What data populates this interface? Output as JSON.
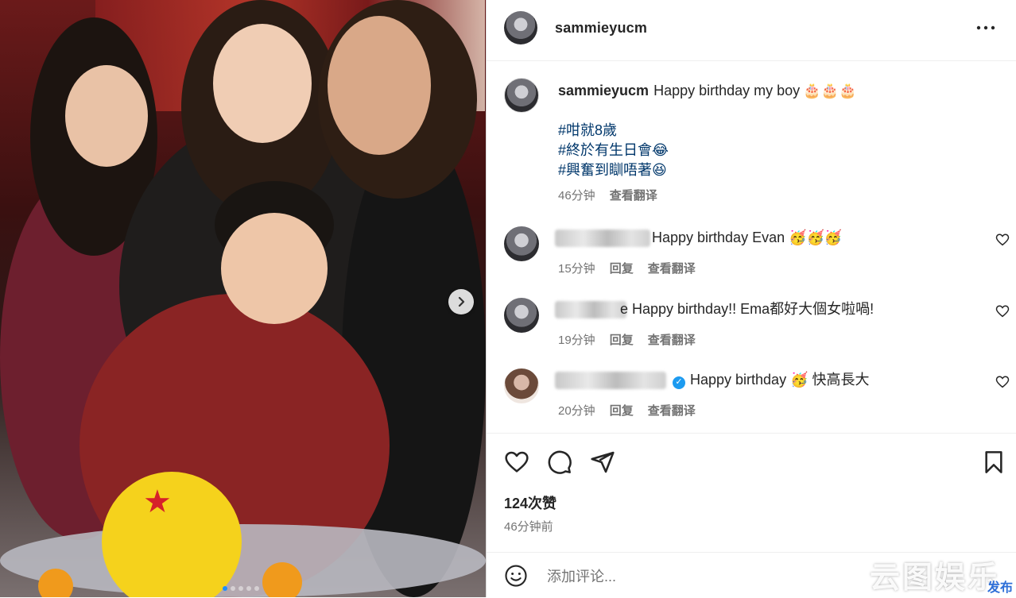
{
  "post": {
    "username": "sammieyucm",
    "caption": {
      "username": "sammieyucm",
      "text": "Happy birthday my boy",
      "emoji": "🎂🎂🎂",
      "hashtags": [
        "#咁就8歲",
        "#終於有生日會😂",
        "#興奮到瞓唔著😆"
      ],
      "time": "46分钟",
      "translate": "查看翻译"
    },
    "comments": [
      {
        "name_hidden": "",
        "text": "Happy birthday Evan 🥳🥳🥳",
        "time": "15分钟",
        "reply": "回复",
        "translate": "查看翻译",
        "like_icon": "heart-outline-icon"
      },
      {
        "name_hidden": "",
        "text": "e Happy birthday!! Ema都好大個女啦喎!",
        "time": "19分钟",
        "reply": "回复",
        "translate": "查看翻译",
        "like_icon": "heart-outline-icon"
      },
      {
        "name_hidden": "",
        "verified": true,
        "text": "Happy birthday 🥳 快高長大",
        "time": "20分钟",
        "reply": "回复",
        "translate": "查看翻译",
        "like_icon": "heart-outline-icon"
      }
    ],
    "likes": "124次赞",
    "posted_ago": "46分钟前",
    "add_comment_placeholder": "添加评论...",
    "carousel": {
      "slides": 5,
      "active_index": 0
    }
  },
  "watermark": {
    "text": "云图娱乐",
    "sub": "发布"
  },
  "colors": {
    "link": "#00376b",
    "muted": "#737373",
    "dot_active": "#1e8fff",
    "verified": "#1d9bf0"
  }
}
